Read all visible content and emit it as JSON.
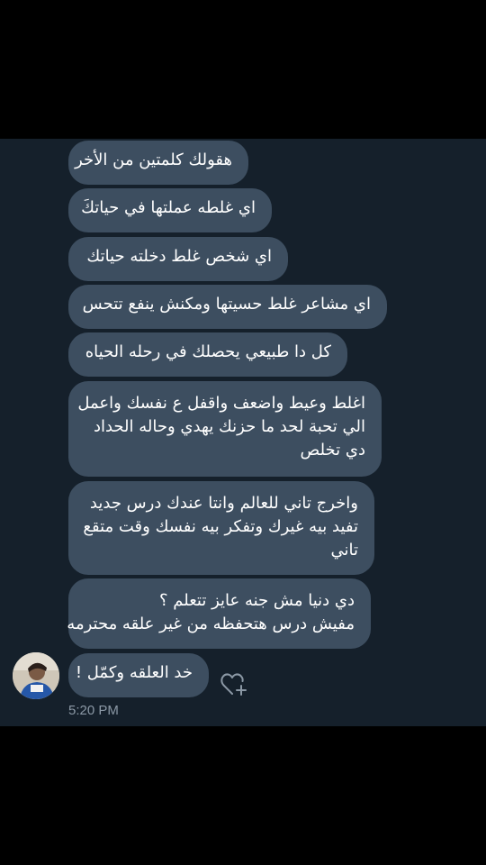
{
  "messages": [
    {
      "lines": [
        "هقولك كلمتين من الأخر"
      ]
    },
    {
      "lines": [
        "اي غلطه عملتها في حياتكَ"
      ]
    },
    {
      "lines": [
        "اي شخص غلط دخلته حياتك"
      ]
    },
    {
      "lines": [
        "اي مشاعر غلط حسيتها ومكنش ينفع تتحس"
      ]
    },
    {
      "lines": [
        "كل دا طبيعي يحصلك في رحله الحياه"
      ]
    },
    {
      "lines": [
        "اغلط وعيط واضعف واقفل ع نفسك واعمل",
        "الي تحبة لحد ما حزنك يهدي وحاله الحداد",
        "دي تخلص"
      ]
    },
    {
      "lines": [
        "واخرج تاني للعالم وانتا عندك درس جديد",
        "تفيد بيه غيرك وتفكر بيه نفسك وقت متقع",
        "تاني"
      ]
    },
    {
      "lines": [
        "دي دنيا مش جنه عايز تتعلم ؟",
        "مفيش درس هتحفظه من غير علقه محترمه"
      ]
    },
    {
      "lines": [
        "خد العلقه وكمّل !"
      ]
    }
  ],
  "timestamp": "5:20 PM",
  "icons": {
    "avatar": "avatar-photo",
    "reaction": "add-reaction-heart-icon"
  },
  "colors": {
    "background": "#15202b",
    "bubble": "#3d4e60",
    "text": "#ffffff",
    "muted": "#8b98a5"
  }
}
